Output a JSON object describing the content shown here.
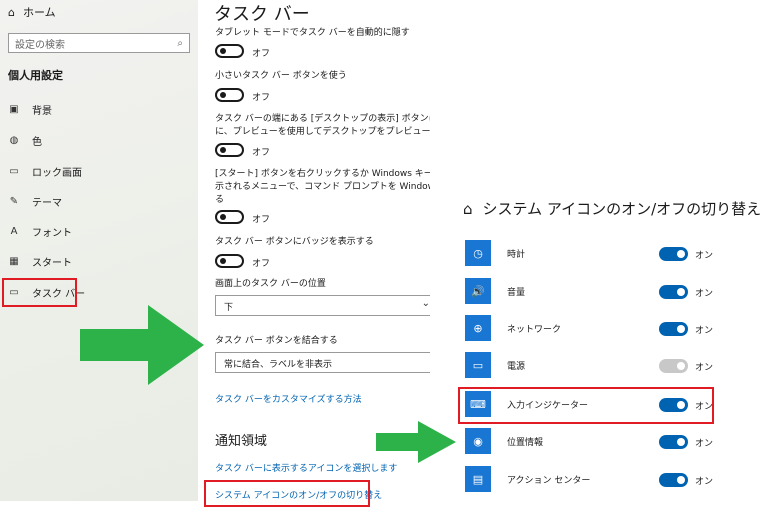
{
  "sidebar": {
    "home_label": "ホーム",
    "search_placeholder": "設定の検索",
    "section_title": "個人用設定",
    "items": [
      {
        "label": "背景",
        "icon": "image-icon"
      },
      {
        "label": "色",
        "icon": "palette-icon"
      },
      {
        "label": "ロック画面",
        "icon": "lock-screen-icon"
      },
      {
        "label": "テーマ",
        "icon": "theme-icon"
      },
      {
        "label": "フォント",
        "icon": "font-icon"
      },
      {
        "label": "スタート",
        "icon": "start-icon"
      },
      {
        "label": "タスク バー",
        "icon": "taskbar-icon",
        "selected": true
      }
    ]
  },
  "taskbar": {
    "title": "タスク バー",
    "settings": [
      {
        "label": "タブレット モードでタスク バーを自動的に隠す",
        "state": "オフ"
      },
      {
        "label": "小さいタスク バー ボタンを使う",
        "state": "オフ"
      },
      {
        "label_lines": [
          "タスク バーの端にある [デスクトップの表示] ボタンにマウスを",
          "に、プレビューを使用してデスクトップをプレビューする"
        ],
        "state": "オフ"
      },
      {
        "label_lines": [
          "[スタート] ボタンを右クリックするか Windows キー + X キー",
          "示されるメニューで、コマンド プロンプトを Windows PowerS",
          "る"
        ],
        "state": "オフ"
      },
      {
        "label": "タスク バー ボタンにバッジを表示する",
        "state": "オフ"
      }
    ],
    "position_label": "画面上のタスク バーの位置",
    "position_value": "下",
    "combine_label": "タスク バー ボタンを結合する",
    "combine_value": "常に結合、ラベルを非表示",
    "customize_link": "タスク バーをカスタマイズする方法",
    "notification_title": "通知領域",
    "select_icons_link": "タスク バーに表示するアイコンを選択します",
    "system_icons_link": "システム アイコンのオン/オフの切り替え"
  },
  "system_icons": {
    "title": "システム アイコンのオン/オフの切り替え",
    "rows": [
      {
        "label": "時計",
        "state": "オン",
        "icon": "clock-icon",
        "glyph": "◷"
      },
      {
        "label": "音量",
        "state": "オン",
        "icon": "volume-icon",
        "glyph": "🔊"
      },
      {
        "label": "ネットワーク",
        "state": "オン",
        "icon": "network-icon",
        "glyph": "⊕"
      },
      {
        "label": "電源",
        "state": "オン",
        "icon": "battery-icon",
        "glyph": "▭",
        "disabled": true
      },
      {
        "label": "入力インジケーター",
        "state": "オン",
        "icon": "keyboard-icon",
        "glyph": "⌨"
      },
      {
        "label": "位置情報",
        "state": "オン",
        "icon": "location-icon",
        "glyph": "◉"
      },
      {
        "label": "アクション センター",
        "state": "オン",
        "icon": "action-center-icon",
        "glyph": "▤"
      }
    ]
  },
  "colors": {
    "accent": "#0063b1",
    "highlight_box": "#e01b24",
    "arrow": "#2db24a",
    "icon_tile": "#1976d2"
  }
}
